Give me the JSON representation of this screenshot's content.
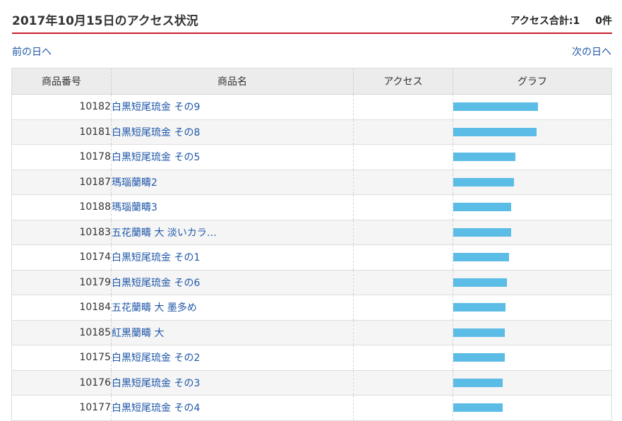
{
  "header": {
    "title": "2017年10月15日のアクセス状況",
    "total_label": "アクセス合計:1",
    "total_count": "0件"
  },
  "nav": {
    "prev_label": "前の日へ",
    "next_label": "次の日へ"
  },
  "table": {
    "columns": [
      "商品番号",
      "商品名",
      "アクセス",
      "グラフ"
    ],
    "rows": [
      {
        "id": "10182",
        "name": "白黒短尾琉金 その9",
        "access": "",
        "bar": 1.0
      },
      {
        "id": "10181",
        "name": "白黒短尾琉金 その8",
        "access": "",
        "bar": 0.98
      },
      {
        "id": "10178",
        "name": "白黒短尾琉金 その5",
        "access": "",
        "bar": 0.73
      },
      {
        "id": "10187",
        "name": "瑪瑙蘭疇2",
        "access": "",
        "bar": 0.72
      },
      {
        "id": "10188",
        "name": "瑪瑙蘭疇3",
        "access": "",
        "bar": 0.68
      },
      {
        "id": "10183",
        "name": "五花蘭疇 大 淡いカラ…",
        "access": "",
        "bar": 0.68
      },
      {
        "id": "10174",
        "name": "白黒短尾琉金 その1",
        "access": "",
        "bar": 0.66
      },
      {
        "id": "10179",
        "name": "白黒短尾琉金 その6",
        "access": "",
        "bar": 0.63
      },
      {
        "id": "10184",
        "name": "五花蘭疇 大 墨多め",
        "access": "",
        "bar": 0.62
      },
      {
        "id": "10185",
        "name": "紅黒蘭疇 大",
        "access": "",
        "bar": 0.61
      },
      {
        "id": "10175",
        "name": "白黒短尾琉金 その2",
        "access": "",
        "bar": 0.61
      },
      {
        "id": "10176",
        "name": "白黒短尾琉金 その3",
        "access": "",
        "bar": 0.58
      },
      {
        "id": "10177",
        "name": "白黒短尾琉金 その4",
        "access": "",
        "bar": 0.58
      }
    ]
  },
  "colors": {
    "accent_line": "#cc1f2f",
    "link": "#1f57a8",
    "bar": "#5bbde6"
  }
}
